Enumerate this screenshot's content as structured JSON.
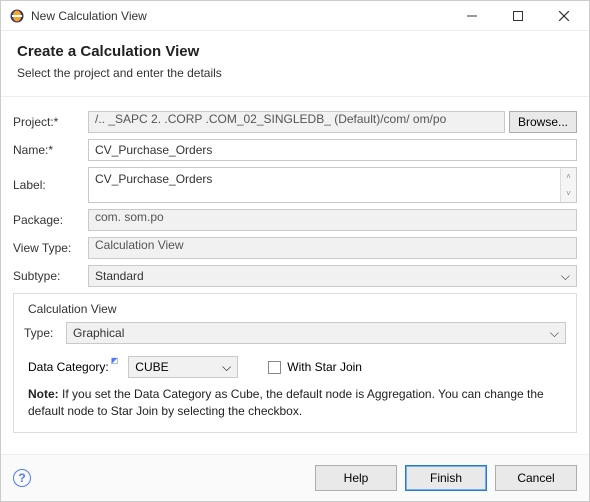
{
  "window": {
    "title": "New Calculation View"
  },
  "header": {
    "heading": "Create a Calculation View",
    "subtitle": "Select the project and enter the details"
  },
  "labels": {
    "project": "Project:*",
    "name": "Name:*",
    "label": "Label:",
    "package": "Package:",
    "viewtype": "View Type:",
    "subtype": "Subtype:",
    "cvlegend": "Calculation View",
    "type": "Type:",
    "datacategory": "Data Category:",
    "withstarjoin": "With Star Join",
    "note_prefix": "Note:",
    "note_text": "If you set the Data Category as Cube, the default node is Aggregation. You can change the default node to Star Join by selecting the checkbox."
  },
  "values": {
    "project": "/..   _SAPC     2.    .CORP        .COM_02_SINGLEDB_ (Default)/com/       om/po",
    "name": "CV_Purchase_Orders",
    "label": "CV_Purchase_Orders",
    "package": "com.       som.po",
    "viewtype": "Calculation View",
    "subtype": "Standard",
    "type": "Graphical",
    "datacategory": "CUBE"
  },
  "buttons": {
    "browse": "Browse...",
    "help": "Help",
    "finish": "Finish",
    "cancel": "Cancel"
  }
}
